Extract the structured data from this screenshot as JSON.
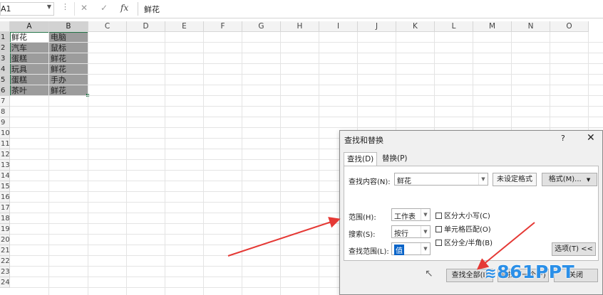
{
  "formula_bar": {
    "name_box": "A1",
    "cancel_glyph": "✕",
    "enter_glyph": "✓",
    "fx_label": "fx",
    "content": "鲜花"
  },
  "sheet": {
    "columns": [
      "A",
      "B",
      "C",
      "D",
      "E",
      "F",
      "G",
      "H",
      "I",
      "J",
      "K",
      "L",
      "M",
      "N",
      "O"
    ],
    "rows": [
      "1",
      "2",
      "3",
      "4",
      "5",
      "6",
      "7",
      "8",
      "9",
      "10",
      "11",
      "12",
      "13",
      "14",
      "15",
      "16",
      "17",
      "18",
      "19",
      "20",
      "21",
      "22",
      "23",
      "24"
    ],
    "cells": [
      {
        "a": "鲜花",
        "b": "电脑"
      },
      {
        "a": "汽车",
        "b": "鼠标"
      },
      {
        "a": "蛋糕",
        "b": "鲜花"
      },
      {
        "a": "玩具",
        "b": "鲜花"
      },
      {
        "a": "蛋糕",
        "b": "手办"
      },
      {
        "a": "茶叶",
        "b": "鲜花"
      }
    ]
  },
  "dialog": {
    "title": "查找和替换",
    "help": "?",
    "close": "✕",
    "tabs": {
      "find": "查找(D)",
      "replace": "替换(P)"
    },
    "find_what_label": "查找内容(N):",
    "find_what_value": "鲜花",
    "format_status": "未设定格式",
    "format_button": "格式(M)...",
    "within_label": "范围(H):",
    "within_value": "工作表",
    "search_label": "搜索(S):",
    "search_value": "按行",
    "look_in_label": "查找范围(L):",
    "look_in_value": "值",
    "match_case": "区分大小写(C)",
    "match_cell": "单元格匹配(O)",
    "match_width": "区分全/半角(B)",
    "options_button": "选项(T) <<",
    "find_all_button": "查找全部(I)",
    "find_next_button": "查找下一个(F)",
    "close_button": "关闭"
  },
  "watermark": "861PPT",
  "colors": {
    "arrow": "#e53935",
    "selection": "#9c9c9c",
    "accent": "#217346",
    "watermark": "#2a8fe8"
  }
}
